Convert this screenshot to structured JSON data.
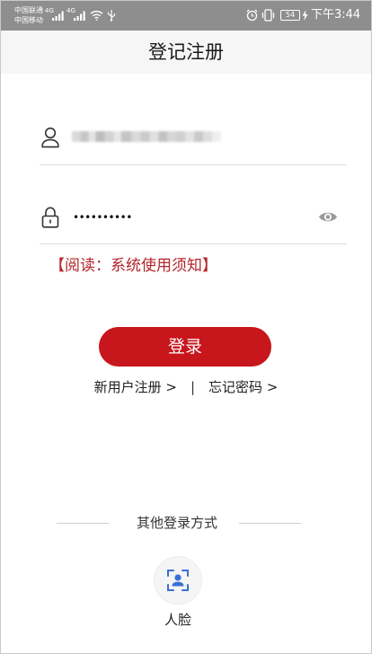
{
  "status_bar": {
    "carrier_1": "中国联通",
    "carrier_2": "中国移动",
    "network_1": "4G",
    "network_2": "4G",
    "battery_level": "54",
    "time": "下午3:44"
  },
  "header": {
    "title": "登记注册"
  },
  "form": {
    "password_value": "••••••••••",
    "notice_link": "【阅读：系统使用须知】"
  },
  "login_button": {
    "label": "登录"
  },
  "links": {
    "register": "新用户注册 >",
    "separator": "|",
    "forgot_password": "忘记密码 >"
  },
  "alt_login": {
    "heading": "其他登录方式",
    "face_label": "人脸"
  },
  "icons": {
    "username": "user-icon",
    "password": "lock-icon",
    "toggle_visibility": "eye-icon",
    "face_login": "face-scan-icon"
  },
  "colors": {
    "primary": "#c8161d",
    "notice": "#b3262a",
    "face": "#3a6fd8",
    "statusbar": "#8e8e8e"
  }
}
